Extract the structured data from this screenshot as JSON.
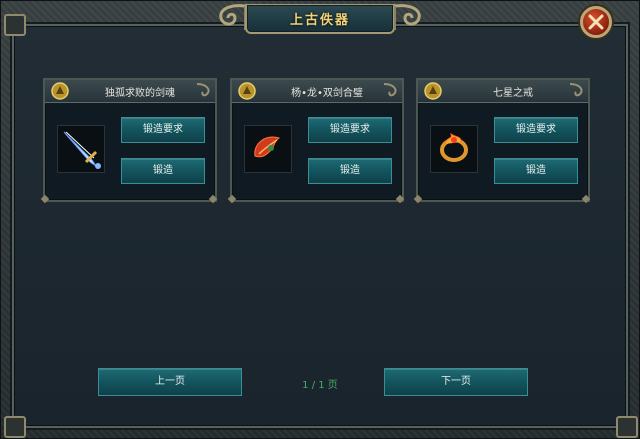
{
  "window": {
    "title": "上古佚器"
  },
  "items": [
    {
      "name": "独孤求败的剑魂",
      "requirements_label": "锻造要求",
      "forge_label": "锻造",
      "icon": "sword-icon"
    },
    {
      "name": "杨•龙•双剑合璧",
      "requirements_label": "锻造要求",
      "forge_label": "锻造",
      "icon": "red-feather-blade-icon"
    },
    {
      "name": "七星之戒",
      "requirements_label": "锻造要求",
      "forge_label": "锻造",
      "icon": "fire-ring-icon"
    }
  ],
  "pager": {
    "prev_label": "上一页",
    "next_label": "下一页",
    "current_page": 1,
    "total_pages": 1,
    "indicator": "1 / 1 页"
  },
  "colors": {
    "title_text": "#f0d277",
    "button_teal": "#145660",
    "page_indicator": "#3fae6a",
    "close_button": "#c0391b"
  }
}
